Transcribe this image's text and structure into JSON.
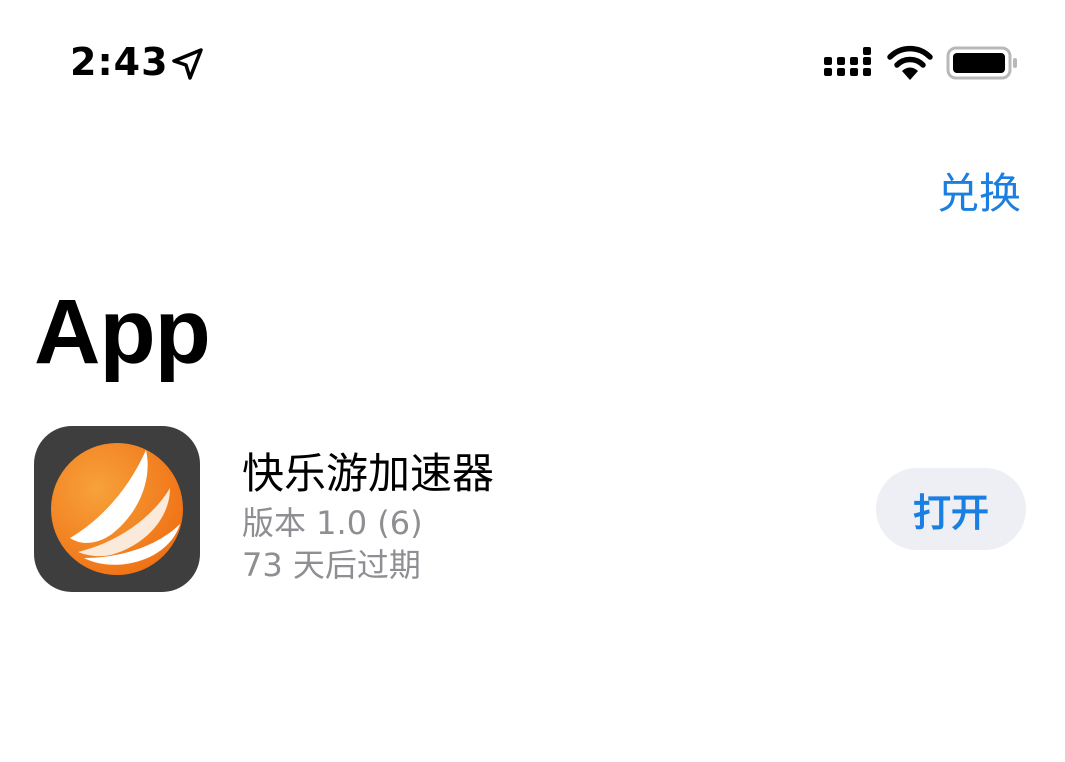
{
  "status_bar": {
    "time": "2:43",
    "icons": [
      "location-arrow-icon",
      "signal-icon",
      "wifi-icon",
      "battery-icon"
    ]
  },
  "header": {
    "redeem_label": "兑换"
  },
  "section": {
    "title": "App"
  },
  "app": {
    "name": "快乐游加速器",
    "version": "版本 1.0 (6)",
    "expiry": "73 天后过期",
    "open_label": "打开",
    "icon": "app-logo-icon"
  },
  "colors": {
    "accent": "#1a7fe0",
    "secondary_text": "#8e8e93",
    "button_bg": "#eeeff4",
    "icon_bg": "#3e3e3e",
    "icon_orange": "#f28a1c"
  }
}
